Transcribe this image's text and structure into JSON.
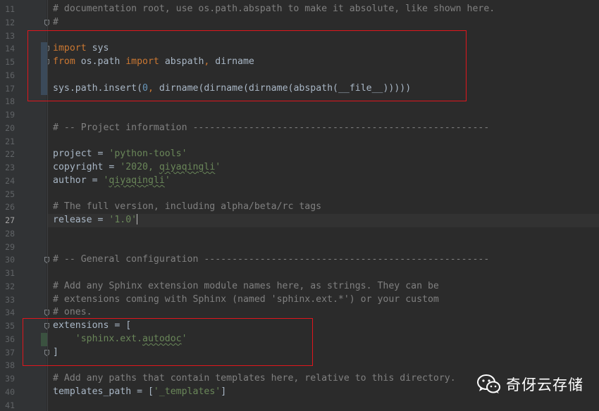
{
  "editor": {
    "current_line": 27,
    "lines": [
      {
        "num": 11,
        "segs": [
          {
            "t": "# documentation root, use os.path.abspath to make it absolute, like shown here.",
            "c": "c"
          }
        ]
      },
      {
        "num": 12,
        "fold": true,
        "segs": [
          {
            "t": "#",
            "c": "c"
          }
        ]
      },
      {
        "num": 13,
        "segs": []
      },
      {
        "num": 14,
        "fold": true,
        "segs": [
          {
            "t": "import",
            "c": "k"
          },
          {
            "t": " sys"
          }
        ]
      },
      {
        "num": 15,
        "fold": true,
        "segs": [
          {
            "t": "from",
            "c": "k"
          },
          {
            "t": " os.path "
          },
          {
            "t": "import",
            "c": "k"
          },
          {
            "t": " abspath"
          },
          {
            "t": ",",
            "c": "k"
          },
          {
            "t": " dirname"
          }
        ]
      },
      {
        "num": 16,
        "segs": []
      },
      {
        "num": 17,
        "segs": [
          {
            "t": "sys.path.insert("
          },
          {
            "t": "0",
            "c": "n"
          },
          {
            "t": ",",
            "c": "k"
          },
          {
            "t": " dirname(dirname(dirname(abspath(__file__)))))"
          }
        ]
      },
      {
        "num": 18,
        "segs": []
      },
      {
        "num": 19,
        "segs": []
      },
      {
        "num": 20,
        "segs": [
          {
            "t": "# -- Project information -----------------------------------------------------",
            "c": "c"
          }
        ]
      },
      {
        "num": 21,
        "segs": []
      },
      {
        "num": 22,
        "segs": [
          {
            "t": "project = "
          },
          {
            "t": "'python-tools'",
            "c": "s"
          }
        ]
      },
      {
        "num": 23,
        "segs": [
          {
            "t": "copyright = "
          },
          {
            "t": "'2020, ",
            "c": "s"
          },
          {
            "t": "qiyaqingli",
            "c": "s typo"
          },
          {
            "t": "'",
            "c": "s"
          }
        ]
      },
      {
        "num": 24,
        "segs": [
          {
            "t": "author = "
          },
          {
            "t": "'",
            "c": "s"
          },
          {
            "t": "qiyaqingli",
            "c": "s typo"
          },
          {
            "t": "'",
            "c": "s"
          }
        ]
      },
      {
        "num": 25,
        "segs": []
      },
      {
        "num": 26,
        "segs": [
          {
            "t": "# The full version, including alpha/beta/rc tags",
            "c": "c"
          }
        ]
      },
      {
        "num": 27,
        "caret": true,
        "segs": [
          {
            "t": "release = "
          },
          {
            "t": "'1.0'",
            "c": "s"
          }
        ]
      },
      {
        "num": 28,
        "segs": []
      },
      {
        "num": 29,
        "segs": []
      },
      {
        "num": 30,
        "fold": true,
        "segs": [
          {
            "t": "# -- General configuration ---------------------------------------------------",
            "c": "c"
          }
        ]
      },
      {
        "num": 31,
        "segs": []
      },
      {
        "num": 32,
        "segs": [
          {
            "t": "# Add any Sphinx extension module names here, as strings. They can be",
            "c": "c"
          }
        ]
      },
      {
        "num": 33,
        "segs": [
          {
            "t": "# extensions coming with Sphinx (named 'sphinx.ext.*') or your custom",
            "c": "c"
          }
        ]
      },
      {
        "num": 34,
        "fold": true,
        "segs": [
          {
            "t": "# ones.",
            "c": "c"
          }
        ]
      },
      {
        "num": 35,
        "fold": true,
        "segs": [
          {
            "t": "extensions = ["
          }
        ]
      },
      {
        "num": 36,
        "segs": [
          {
            "t": "    "
          },
          {
            "t": "'sphinx.ext.",
            "c": "s"
          },
          {
            "t": "autodoc",
            "c": "s typo"
          },
          {
            "t": "'",
            "c": "s"
          }
        ]
      },
      {
        "num": 37,
        "fold": true,
        "segs": [
          {
            "t": "]"
          }
        ]
      },
      {
        "num": 38,
        "segs": []
      },
      {
        "num": 39,
        "segs": [
          {
            "t": "# Add any paths that contain templates here, relative to this directory.",
            "c": "c"
          }
        ]
      },
      {
        "num": 40,
        "segs": [
          {
            "t": "templates_path = ["
          },
          {
            "t": "'_templates'",
            "c": "s"
          },
          {
            "t": "]"
          }
        ]
      },
      {
        "num": 41,
        "segs": []
      }
    ]
  },
  "watermark": {
    "text": "奇伢云存储",
    "icon": "wechat-icon"
  },
  "colors": {
    "background": "#2b2b2b",
    "gutter": "#313335",
    "comment": "#808080",
    "keyword": "#cc7832",
    "string": "#6a8759",
    "number": "#6897bb",
    "default_text": "#a9b7c6",
    "highlight_box": "#e0161d"
  }
}
